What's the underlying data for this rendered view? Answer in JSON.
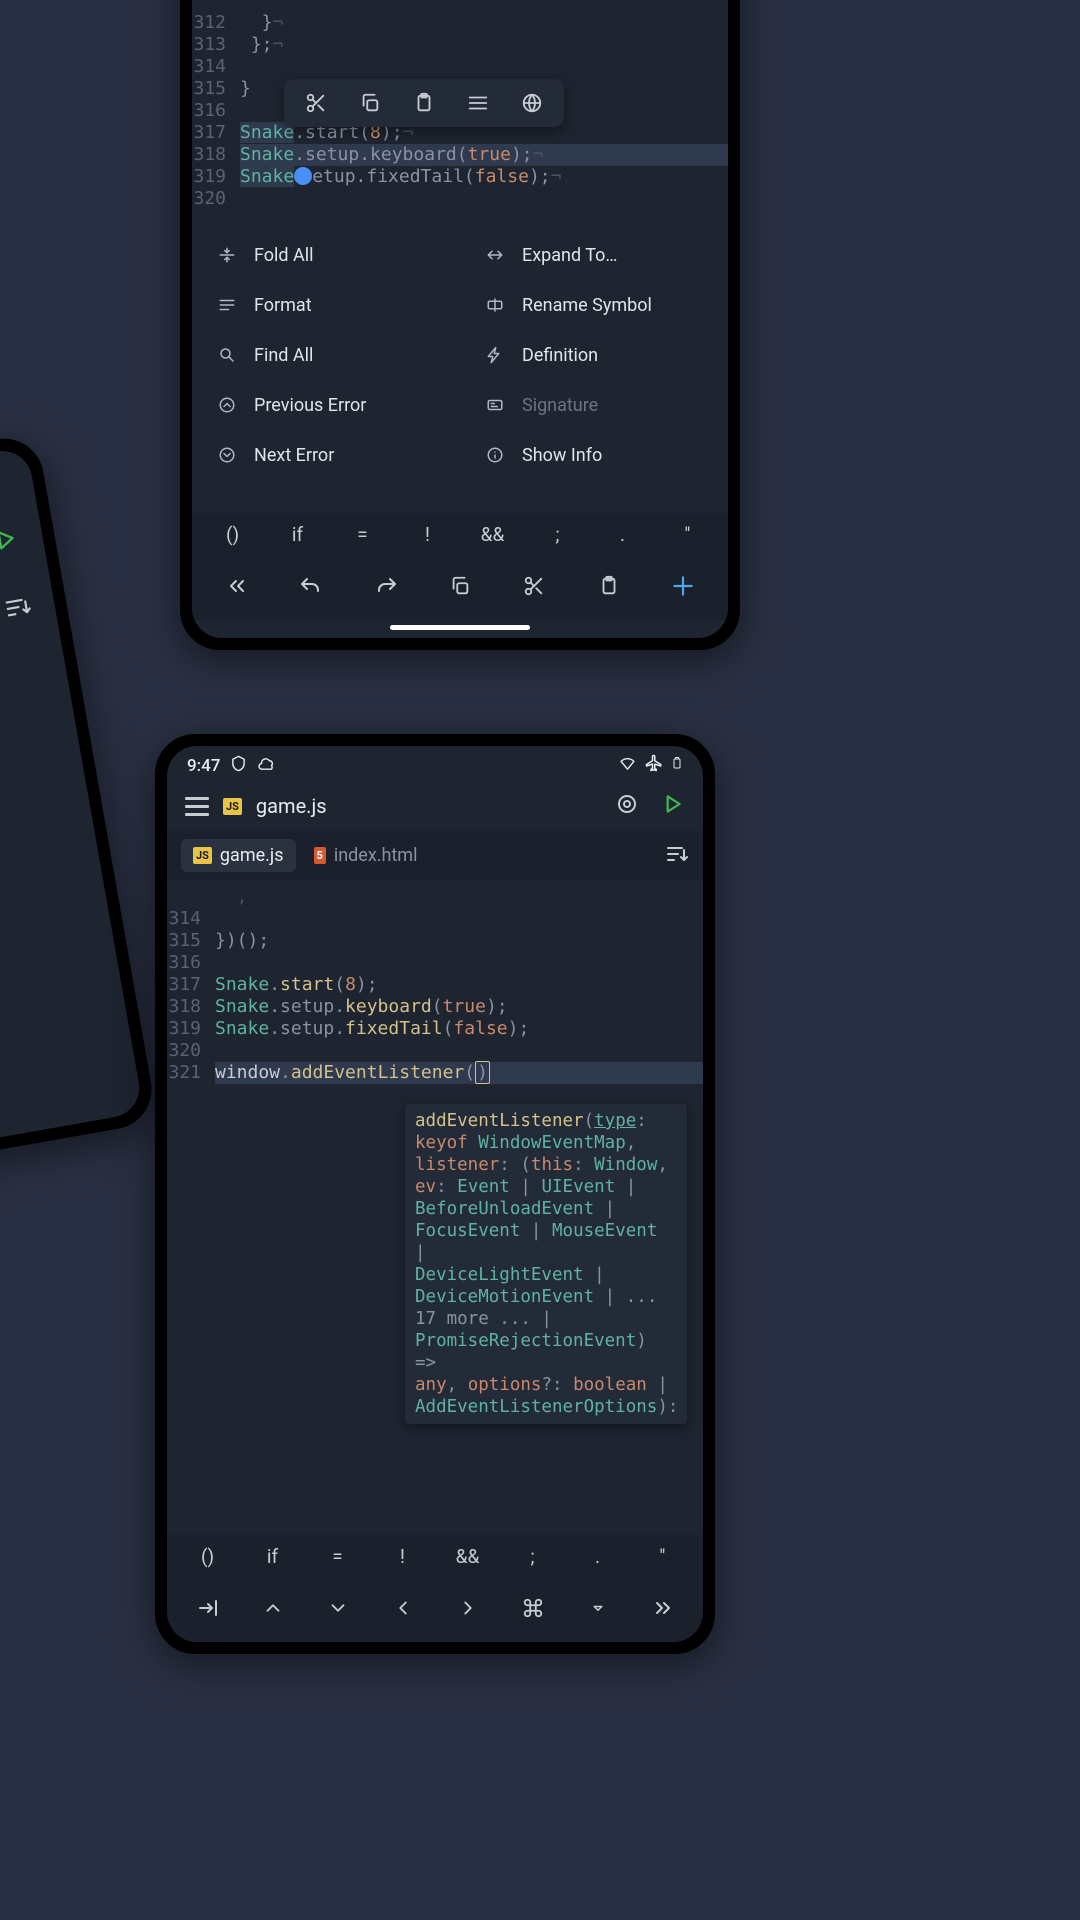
{
  "app": {
    "time": "9:47",
    "file_title": "game.js"
  },
  "tabs": [
    {
      "label": "game.js",
      "type": "js",
      "active": true
    },
    {
      "label": "index.html",
      "type": "html",
      "active": false
    }
  ],
  "phone1_code": {
    "lines": [
      {
        "n": "312",
        "raw": " }"
      },
      {
        "n": "313",
        "raw": " };"
      },
      {
        "n": "314",
        "raw": ""
      },
      {
        "n": "315",
        "raw": ""
      },
      {
        "n": "316",
        "raw": ""
      },
      {
        "n": "317",
        "segments": [
          "Snake",
          ".start(",
          "8",
          ");"
        ]
      },
      {
        "n": "318",
        "segments": [
          "Snake",
          ".setup.keyboard(",
          "true",
          ");"
        ]
      },
      {
        "n": "319",
        "segments": [
          "Snake",
          ".setup.fixedTail(",
          "false",
          ");"
        ]
      },
      {
        "n": "320",
        "raw": ""
      }
    ]
  },
  "context_menu": {
    "left": [
      {
        "label": "Fold All",
        "icon": "fold"
      },
      {
        "label": "Format",
        "icon": "format"
      },
      {
        "label": "Find All",
        "icon": "search"
      },
      {
        "label": "Previous Error",
        "icon": "prev-error"
      },
      {
        "label": "Next Error",
        "icon": "next-error"
      }
    ],
    "right": [
      {
        "label": "Expand To…",
        "icon": "expand"
      },
      {
        "label": "Rename Symbol",
        "icon": "rename"
      },
      {
        "label": "Definition",
        "icon": "definition"
      },
      {
        "label": "Signature",
        "icon": "signature",
        "disabled": true
      },
      {
        "label": "Show Info",
        "icon": "info"
      }
    ]
  },
  "quick_keys": [
    "()",
    "if",
    "=",
    "!",
    "&&",
    ";",
    ".",
    "''"
  ],
  "phone2_code": {
    "lines": [
      {
        "n": "314",
        "raw": ""
      },
      {
        "n": "315",
        "raw": "})();"
      },
      {
        "n": "316",
        "raw": ""
      },
      {
        "n": "317",
        "segments": [
          "Snake",
          ".",
          "start",
          "(",
          "8",
          ");"
        ]
      },
      {
        "n": "318",
        "segments": [
          "Snake",
          ".setup.",
          "keyboard",
          "(",
          "true",
          ");"
        ]
      },
      {
        "n": "319",
        "segments": [
          "Snake",
          ".setup.",
          "fixedTail",
          "(",
          "false",
          ");"
        ]
      },
      {
        "n": "320",
        "raw": ""
      },
      {
        "n": "321",
        "segments": [
          "window",
          ".",
          "addEventListener",
          "()"
        ]
      }
    ]
  },
  "signature": {
    "text": "addEventListener(type: keyof WindowEventMap, listener: (this: Window, ev: Event | UIEvent | BeforeUnloadEvent | FocusEvent | MouseEvent | DeviceLightEvent | DeviceMotionEvent | ... 17 more ... | PromiseRejectionEvent) => any, options?: boolean | AddEventListenerOptions):"
  },
  "quick_keys2": [
    "()",
    "if",
    "=",
    "!",
    "&&",
    ";",
    ".",
    "''"
  ]
}
